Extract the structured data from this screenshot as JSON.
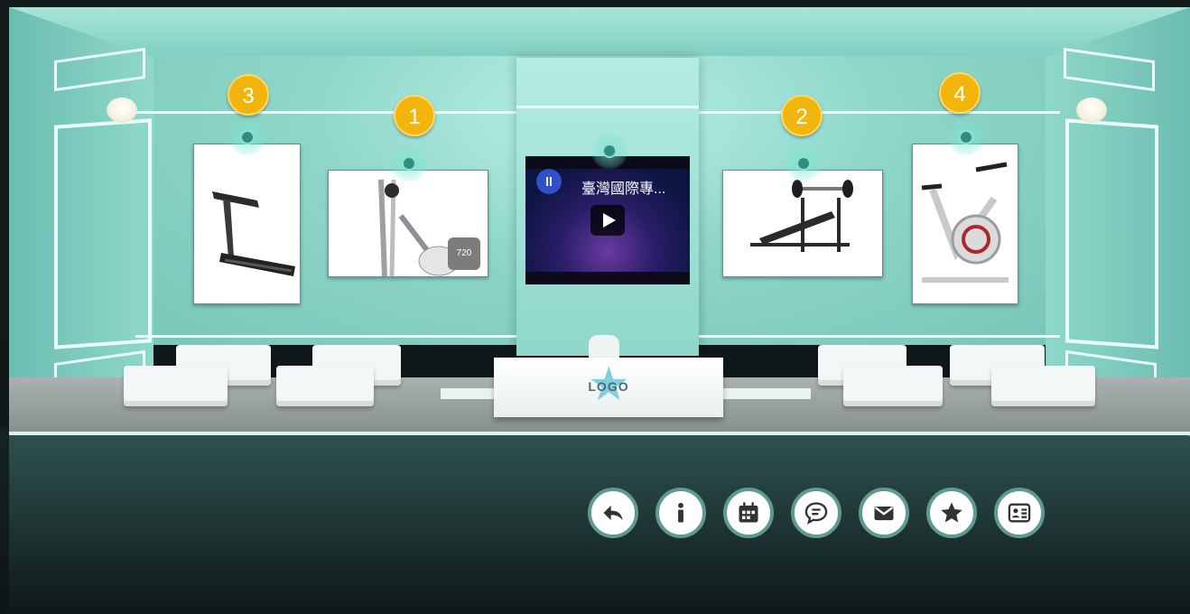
{
  "booth": {
    "logo_text": "LOGO"
  },
  "video": {
    "title": "臺灣國際專...",
    "brand_mark": "ll"
  },
  "posters": [
    {
      "number": "3",
      "product": "treadmill"
    },
    {
      "number": "1",
      "product": "elliptical trainer"
    },
    {
      "number": "2",
      "product": "weight bench"
    },
    {
      "number": "4",
      "product": "spin bike"
    }
  ],
  "badge_360": "720",
  "toolbar": {
    "buttons": [
      {
        "icon": "back-arrow-icon"
      },
      {
        "icon": "info-icon"
      },
      {
        "icon": "calendar-icon"
      },
      {
        "icon": "chat-icon"
      },
      {
        "icon": "mail-icon"
      },
      {
        "icon": "star-icon"
      },
      {
        "icon": "contact-card-icon"
      }
    ]
  },
  "colors": {
    "accent": "#f2b50c",
    "wall": "#8ed6ca",
    "button_border": "#5f9a90"
  }
}
